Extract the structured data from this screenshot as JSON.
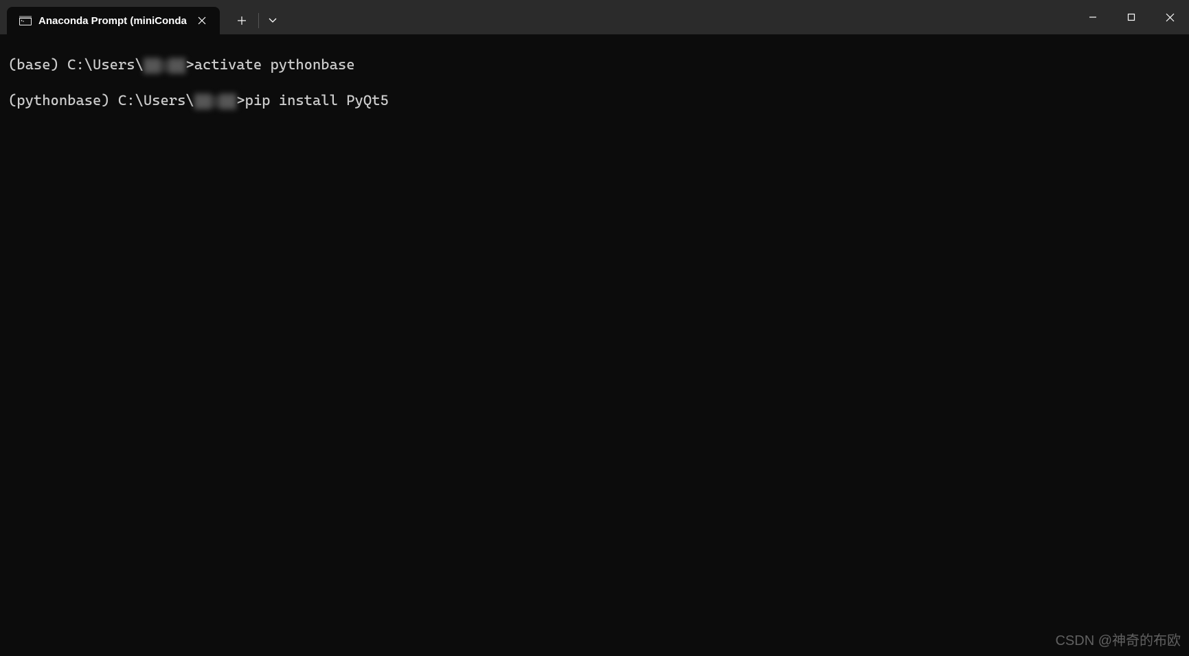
{
  "titlebar": {
    "tab": {
      "title": "Anaconda Prompt (miniConda"
    }
  },
  "terminal": {
    "lines": [
      {
        "prompt_pre": "(base) C:\\Users\\",
        "redacted": "▓▓ ▓▓",
        "prompt_post": ">",
        "command": "activate pythonbase"
      },
      {
        "prompt_pre": "(pythonbase) C:\\Users\\",
        "redacted": "▓▓ ▓▓",
        "prompt_post": ">",
        "command": "pip install PyQt5"
      }
    ]
  },
  "watermark": "CSDN @神奇的布欧"
}
